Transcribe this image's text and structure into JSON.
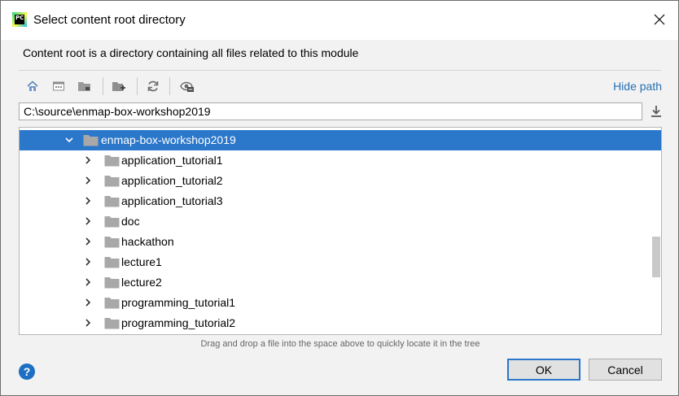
{
  "window": {
    "title": "Select content root directory",
    "app_icon_text": "PC"
  },
  "description": "Content root is a directory containing all files related to this module",
  "toolbar": {
    "icons": [
      "home-icon",
      "desktop-icon",
      "project-folder-icon",
      "new-folder-icon",
      "refresh-icon",
      "show-hidden-icon"
    ],
    "hide_path_label": "Hide path"
  },
  "path_field": {
    "value": "C:\\source\\enmap-box-workshop2019"
  },
  "tree": {
    "selected": {
      "label": "enmap-box-workshop2019",
      "expanded": true
    },
    "children": [
      {
        "label": "application_tutorial1"
      },
      {
        "label": "application_tutorial2"
      },
      {
        "label": "application_tutorial3"
      },
      {
        "label": "doc"
      },
      {
        "label": "hackathon"
      },
      {
        "label": "lecture1"
      },
      {
        "label": "lecture2"
      },
      {
        "label": "programming_tutorial1"
      },
      {
        "label": "programming_tutorial2"
      }
    ]
  },
  "hint": "Drag and drop a file into the space above to quickly locate it in the tree",
  "buttons": {
    "help_label": "?",
    "ok_label": "OK",
    "cancel_label": "Cancel"
  },
  "colors": {
    "selection": "#2b77c9",
    "link": "#2470b3",
    "folder": "#a8a8a8"
  }
}
